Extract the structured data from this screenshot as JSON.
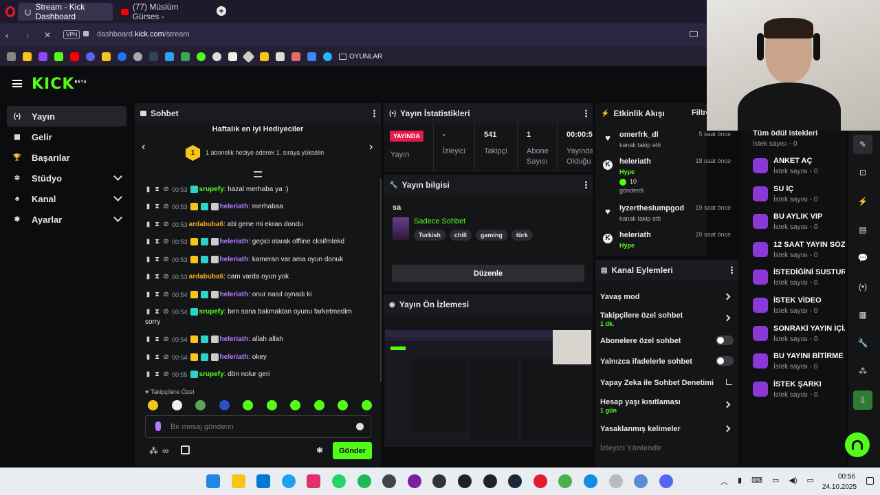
{
  "browser": {
    "tabs": [
      {
        "label": "Stream - Kick Dashboard",
        "active": true
      },
      {
        "label": "(77) Müslüm Gürses -",
        "active": false
      }
    ],
    "vpn_label": "VPN",
    "url_prefix": "dashboard.",
    "url_domain": "kick.com",
    "url_path": "/stream",
    "bookmark_folder": "OYUNLAR"
  },
  "kick": {
    "logo": "KICK",
    "logo_sup": "BETA",
    "sidebar": [
      {
        "label": "Yayın",
        "active": true,
        "icon": "broadcast-icon",
        "glyph": "(•)"
      },
      {
        "label": "Gelir",
        "icon": "revenue-icon",
        "glyph": "▦"
      },
      {
        "label": "Başarılar",
        "icon": "trophy-icon",
        "glyph": "🏆"
      },
      {
        "label": "Stüdyo",
        "icon": "studio-icon",
        "glyph": "✲",
        "expand": true
      },
      {
        "label": "Kanal",
        "icon": "channel-icon",
        "glyph": "♣",
        "expand": true
      },
      {
        "label": "Ayarlar",
        "icon": "settings-icon",
        "glyph": "✱",
        "expand": true
      }
    ]
  },
  "chat": {
    "title": "Sohbet",
    "gifters_title": "Haftalık en iyi Hediyeciler",
    "gifters_rank": "1",
    "gifters_text": "1 abonelik hediye ederek 1. sıraya yükselin",
    "messages": [
      {
        "time": "00:53",
        "user": "srupefy",
        "color": "#53fc18",
        "badges": 1,
        "text": ": hazal merhaba ya :)"
      },
      {
        "time": "00:53",
        "user": "heleriath",
        "color": "#b57cff",
        "badges": 3,
        "text": ": merhabaa"
      },
      {
        "time": "00:53",
        "user": "ardabuba6",
        "color": "#f5a623",
        "badges": 0,
        "text": ": abi gene mi ekran dondu"
      },
      {
        "time": "00:53",
        "user": "heleriath",
        "color": "#b57cff",
        "badges": 3,
        "text": ": geçici olarak offline cksifmlekd"
      },
      {
        "time": "00:53",
        "user": "heleriath",
        "color": "#b57cff",
        "badges": 3,
        "text": ": kameran var ama oyun donuk"
      },
      {
        "time": "00:53",
        "user": "ardabuba6",
        "color": "#f5a623",
        "badges": 0,
        "text": ": cam varda oyun yok"
      },
      {
        "time": "00:54",
        "user": "heleriath",
        "color": "#b57cff",
        "badges": 3,
        "text": ": onur nasıl oynadı ki"
      },
      {
        "time": "00:54",
        "user": "srupefy",
        "color": "#53fc18",
        "badges": 1,
        "text": ": ben sana bakmaktan oyunu farketmedim",
        "wrap": "sorry"
      },
      {
        "time": "00:54",
        "user": "heleriath",
        "color": "#b57cff",
        "badges": 3,
        "text": ": allah allah"
      },
      {
        "time": "00:54",
        "user": "heleriath",
        "color": "#b57cff",
        "badges": 3,
        "text": ": okey"
      },
      {
        "time": "00:55",
        "user": "srupefy",
        "color": "#53fc18",
        "badges": 1,
        "text": ": dön nolur geri"
      }
    ],
    "emote_section": "Takipçilere Özel",
    "input_placeholder": "Bir mesaj gönderin",
    "send_label": "Gönder"
  },
  "stats": {
    "title": "Yayın İstatistikleri",
    "live_badge": "YAYINDA",
    "live_caption": "Yayın",
    "items": [
      {
        "value": "-",
        "label": "İzleyici"
      },
      {
        "value": "541",
        "label": "Takipçi"
      },
      {
        "value": "1",
        "label": "Abone Sayısı"
      },
      {
        "value": "00:00:5",
        "label": "Yayında Olduğu"
      }
    ]
  },
  "stream_info": {
    "title": "Yayın bilgisi",
    "stream_title": "sa",
    "category": "Sadece Sohbet",
    "tags": [
      "Turkish",
      "chill",
      "gaming",
      "türk"
    ],
    "edit_label": "Düzenle"
  },
  "preview": {
    "title": "Yayın Ön İzlemesi"
  },
  "activity": {
    "title": "Etkinlik Akışı",
    "filter_label": "Filtre",
    "items": [
      {
        "user": "omerfrk_dl",
        "time": "5 saat önce",
        "desc": "kanalı takip etti",
        "type": "follow"
      },
      {
        "user": "heleriath",
        "time": "18 saat önce",
        "hype": "Hype",
        "count": "10",
        "desc": "gönderdi",
        "type": "kick"
      },
      {
        "user": "lyzertheslumpgod",
        "time": "19 saat önce",
        "desc": "kanalı takip etti",
        "type": "follow"
      },
      {
        "user": "heleriath",
        "time": "20 saat önce",
        "hype": "Hype",
        "type": "kick"
      }
    ]
  },
  "channel_actions": {
    "title": "Kanal Eylemleri",
    "items": [
      {
        "label": "Yavaş mod",
        "control": "arrow"
      },
      {
        "label": "Takipçilere özel sohbet",
        "sub": "1 dk.",
        "control": "arrow"
      },
      {
        "label": "Abonelere özel sohbet",
        "control": "toggle"
      },
      {
        "label": "Yalnızca ifadelerle sohbet",
        "control": "toggle"
      },
      {
        "label": "Yapay Zeka ile Sohbet Denetimi",
        "control": "external"
      },
      {
        "label": "Hesap yaşı kısıtlaması",
        "sub": "1 gün",
        "control": "arrow"
      },
      {
        "label": "Yasaklanmış kelimeler",
        "control": "arrow"
      },
      {
        "label": "İzleyici Yönlendir",
        "control": "none",
        "dim": true
      }
    ]
  },
  "rewards": {
    "title": "Tüm ödül istekleri",
    "title_sub": "İstek sayısı - 0",
    "items": [
      {
        "title": "ANKET AÇ",
        "sub": "İstek sayısı - 0"
      },
      {
        "title": "SU İÇ",
        "sub": "İstek sayısı - 0"
      },
      {
        "title": "BU AYLIK VIP",
        "sub": "İstek sayısı - 0"
      },
      {
        "title": "12 SAAT YAYIN SÖZÜ",
        "sub": "İstek sayısı - 0"
      },
      {
        "title": "İSTEDİĞİNİ SUSTUR",
        "sub": "İstek sayısı - 0"
      },
      {
        "title": "İSTEK VİDEO",
        "sub": "İstek sayısı - 0"
      },
      {
        "title": "SONRAKİ YAYIN İÇİ..",
        "sub": "İstek sayısı - 0"
      },
      {
        "title": "BU YAYINI BİTİRME ..",
        "sub": "İstek sayısı - 0"
      },
      {
        "title": "İSTEK ŞARKI",
        "sub": "İstek sayısı - 0"
      }
    ]
  },
  "taskbar": {
    "time": "00:56",
    "date": "24.10.2025"
  },
  "colors": {
    "accent": "#53fc18",
    "live": "#e21b47",
    "purple": "#8a38d6"
  }
}
